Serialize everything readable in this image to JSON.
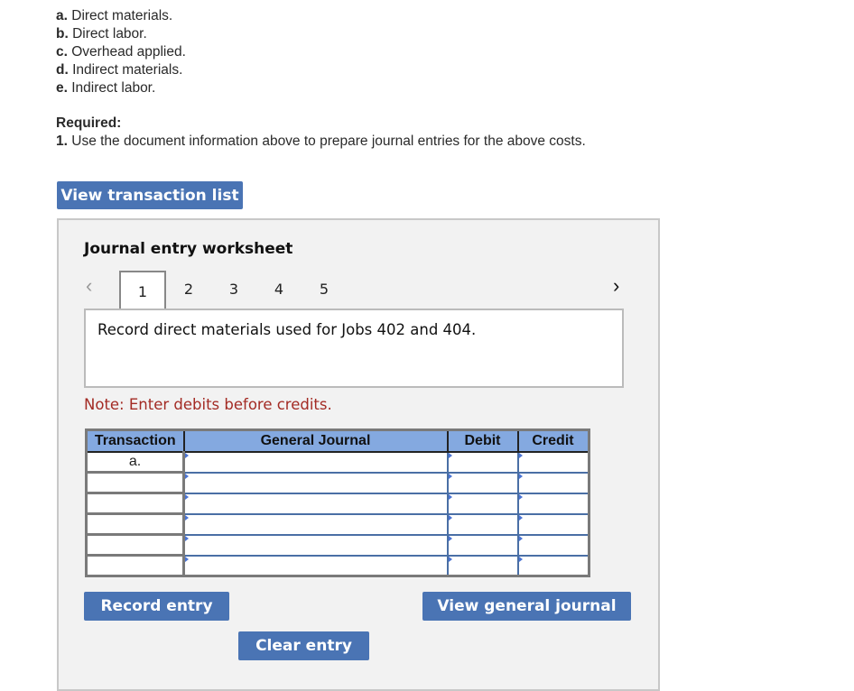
{
  "costs": [
    {
      "letter": "a.",
      "text": " Direct materials."
    },
    {
      "letter": "b.",
      "text": " Direct labor."
    },
    {
      "letter": "c.",
      "text": " Overhead applied."
    },
    {
      "letter": "d.",
      "text": " Indirect materials."
    },
    {
      "letter": "e.",
      "text": " Indirect labor."
    }
  ],
  "required": {
    "heading": "Required:",
    "num": "1.",
    "text": " Use the document information above to prepare journal entries for the above costs."
  },
  "buttons": {
    "view_transaction_list": "View transaction list",
    "record_entry": "Record entry",
    "clear_entry": "Clear entry",
    "view_general_journal": "View general journal"
  },
  "worksheet": {
    "title": "Journal entry worksheet",
    "prev_icon": "‹",
    "next_icon": "›",
    "tabs": [
      "1",
      "2",
      "3",
      "4",
      "5"
    ],
    "active_tab": "1",
    "description": "Record direct materials used for Jobs 402 and 404.",
    "note": "Note: Enter debits before credits."
  },
  "table": {
    "headers": {
      "transaction": "Transaction",
      "general_journal": "General Journal",
      "debit": "Debit",
      "credit": "Credit"
    },
    "rows": [
      {
        "transaction": "a.",
        "account": "",
        "debit": "",
        "credit": ""
      },
      {
        "transaction": "",
        "account": "",
        "debit": "",
        "credit": ""
      },
      {
        "transaction": "",
        "account": "",
        "debit": "",
        "credit": ""
      },
      {
        "transaction": "",
        "account": "",
        "debit": "",
        "credit": ""
      },
      {
        "transaction": "",
        "account": "",
        "debit": "",
        "credit": ""
      },
      {
        "transaction": "",
        "account": "",
        "debit": "",
        "credit": ""
      }
    ]
  }
}
